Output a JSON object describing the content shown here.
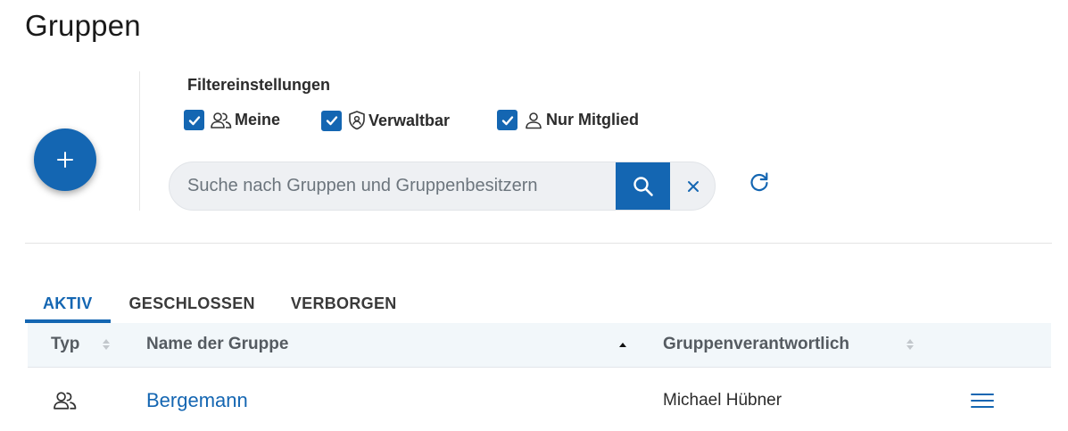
{
  "page": {
    "title": "Gruppen"
  },
  "filters": {
    "title": "Filtereinstellungen",
    "items": [
      {
        "label": "Meine",
        "checked": true,
        "icon": "users-icon"
      },
      {
        "label": "Verwaltbar",
        "checked": true,
        "icon": "shield-icon"
      },
      {
        "label": "Nur Mitglied",
        "checked": true,
        "icon": "user-icon"
      }
    ]
  },
  "search": {
    "placeholder": "Suche nach Gruppen und Gruppenbesitzern",
    "value": ""
  },
  "tabs": [
    {
      "label": "AKTIV",
      "active": true
    },
    {
      "label": "GESCHLOSSEN",
      "active": false
    },
    {
      "label": "VERBORGEN",
      "active": false
    }
  ],
  "table": {
    "columns": [
      {
        "label": "Typ",
        "sort": "none"
      },
      {
        "label": "Name der Gruppe",
        "sort": "ascending"
      },
      {
        "label": "Gruppenverantwortlich",
        "sort": "none"
      }
    ],
    "rows": [
      {
        "type_icon": "users-icon",
        "name": "Bergemann",
        "owner": "Michael Hübner"
      }
    ]
  },
  "colors": {
    "accent": "#1466b2",
    "header_bg": "#f2f7fa",
    "search_bg": "#eef0f3"
  }
}
